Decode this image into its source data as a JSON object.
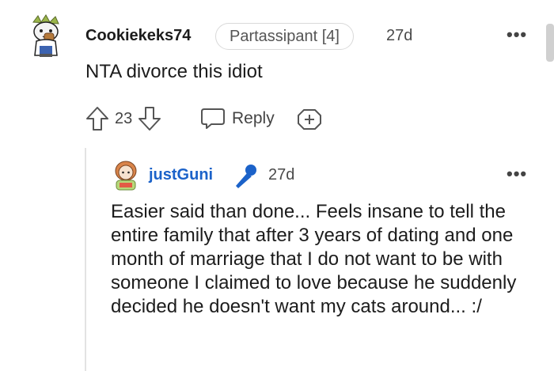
{
  "comment": {
    "username": "Cookiekeks74",
    "flair": "Partassipant [4]",
    "time": "27d",
    "more": "•••",
    "body": "NTA divorce this idiot",
    "upvotes": "23",
    "reply_label": "Reply"
  },
  "reply": {
    "username": "justGuni",
    "time": "27d",
    "more": "•••",
    "body": "Easier said than done... Feels insane to tell the entire family that after 3 years of dating and one month of marriage that I do not want to be with someone I claimed to love because he suddenly decided he doesn't want my cats around... :/"
  },
  "colors": {
    "reply_username": "#1b62c9",
    "op_mic_icon": "#1b62c9"
  }
}
